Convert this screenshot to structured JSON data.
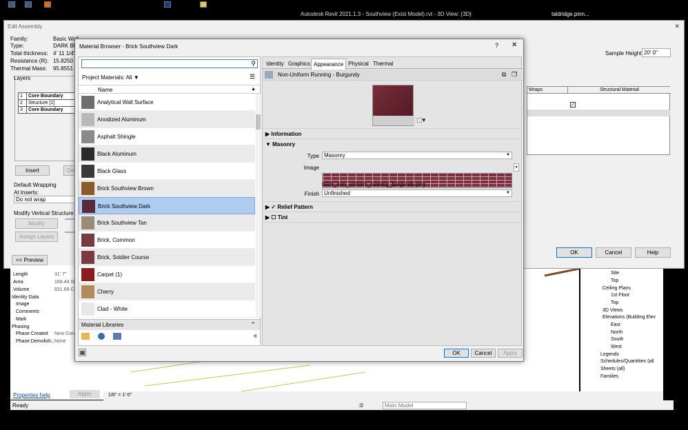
{
  "app": {
    "title": "Autodesk Revit 2021.1.3 - Southview (Exist Model).rvt - 3D View: {3D}",
    "user": "taldridge.pinn..."
  },
  "edit_assembly": {
    "title": "Edit Assembly",
    "family_label": "Family:",
    "family_value": "Basic Wall",
    "type_label": "Type:",
    "type_value": "DARK BRIC",
    "thickness_label": "Total thickness:",
    "thickness_value": "4' 11 1/4\"",
    "resistance_label": "Resistance (R):",
    "resistance_value": "15.8250 (h",
    "mass_label": "Thermal Mass:",
    "mass_value": "95.8551 BT",
    "sample_height_label": "Sample Height:",
    "sample_height_value": "20'  0\"",
    "layers_label": "Layers",
    "layers": [
      {
        "n": "1",
        "name": "Core Boundary"
      },
      {
        "n": "2",
        "name": "Structure [1]"
      },
      {
        "n": "3",
        "name": "Core Boundary"
      }
    ],
    "wraps_header": "Wraps",
    "structural_header": "Structural Material",
    "insert": "Insert",
    "delete": "Dele",
    "default_wrapping": "Default Wrapping",
    "at_inserts": "At Inserts:",
    "at_inserts_value": "Do not wrap",
    "modify_vs": "Modify Vertical Structure (Secti",
    "modify": "Modify",
    "assign_layers": "Assign Layers",
    "preview": "<< Preview",
    "ok": "OK",
    "cancel": "Cancel",
    "help": "Help"
  },
  "material_browser": {
    "title": "Material Browser - Brick Southview Dark",
    "help": "?",
    "close": "✕",
    "search_placeholder": "",
    "project_materials": "Project Materials: All",
    "col_name": "Name",
    "materials": [
      "Analytical Wall Surface",
      "Anodized Aluminum",
      "Asphalt Shingle",
      "Black Aluminum",
      "Black Glass",
      "Brick Southview Brown",
      "Brick Southview Dark",
      "Brick Southview Tan",
      "Brick, Common",
      "Brick, Soldier Course",
      "Carpet (1)",
      "Cherry",
      "Clad - White"
    ],
    "swatch_colors": [
      "#6e6e6e",
      "#b8b8b8",
      "#8a8a8a",
      "#2a2a2a",
      "#3a3a3a",
      "#8a5a2a",
      "#5a2a3a",
      "#9a8a78",
      "#7a3a44",
      "#7a3a44",
      "#8a1e1e",
      "#b58a5a",
      "#e8e8e8"
    ],
    "selected_index": 6,
    "material_libraries": "Material Libraries",
    "tabs": [
      "Identity",
      "Graphics",
      "Appearance",
      "Physical",
      "Thermal"
    ],
    "active_tab": "Appearance",
    "asset_name": "Non-Uniform Running - Burgundy",
    "section_information": "Information",
    "section_masonry": "Masonry",
    "type_label": "Type",
    "type_value": "Masonry",
    "image_label": "Image",
    "image_file": "brick_non_uniform_running_burgundy.png",
    "finish_label": "Finish",
    "finish_value": "Unfinished",
    "relief": "Relief Pattern",
    "tint": "Tint",
    "ok": "OK",
    "cancel": "Cancel",
    "apply": "Apply"
  },
  "properties": {
    "rows": [
      [
        "Length",
        "31'  7\""
      ],
      [
        "Area",
        "168.44 SF"
      ],
      [
        "Volume",
        "831.69 CF"
      ]
    ],
    "identity": "Identity Data",
    "rows2": [
      [
        "Image",
        ""
      ],
      [
        "Comments",
        ""
      ],
      [
        "Mark",
        ""
      ]
    ],
    "phasing": "Phasing",
    "rows3": [
      [
        "Phase Created",
        "New Con"
      ],
      [
        "Phase Demolish...",
        "None"
      ]
    ],
    "help_link": "Properties help",
    "apply": "Apply"
  },
  "project_browser": [
    "Site",
    "Top",
    "Ceiling Plans",
    "1st Floor",
    "Top",
    "3D Views",
    "Elevations (Building Elev",
    "East",
    "North",
    "South",
    "West",
    "Legends",
    "Schedules/Quantities (all",
    "Sheets (all)",
    "Families"
  ],
  "view": {
    "scale": "1/8\" = 1'-0\""
  },
  "status": {
    "ready": "Ready",
    "model": "Main Model",
    "zero": ":0"
  }
}
